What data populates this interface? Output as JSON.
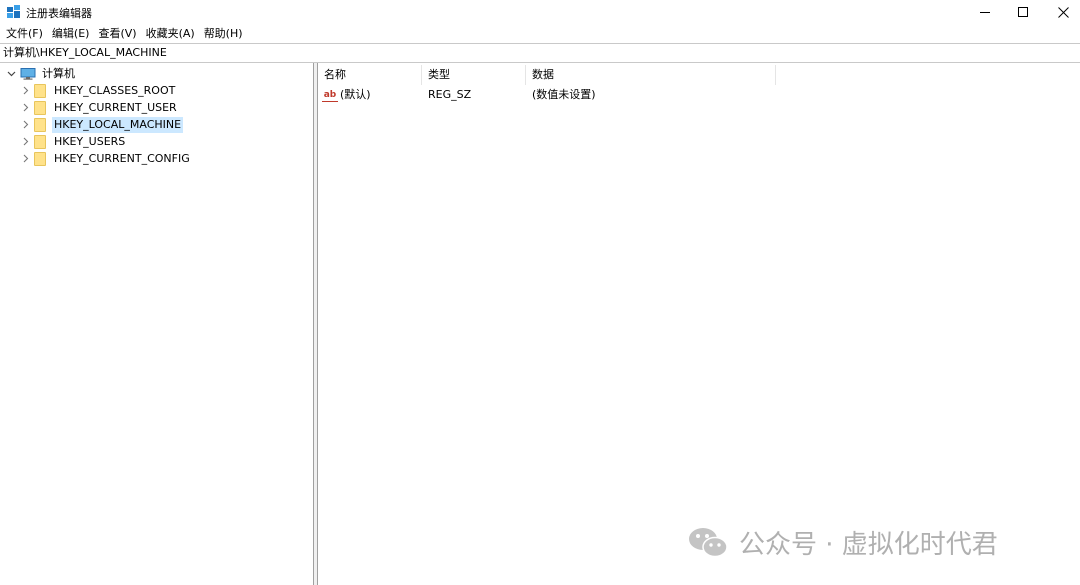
{
  "window": {
    "title": "注册表编辑器",
    "app_icon": "regedit-icon",
    "controls": [
      "minimize-icon",
      "maximize-icon",
      "close-icon"
    ]
  },
  "menu": [
    {
      "label": "文件(F)"
    },
    {
      "label": "编辑(E)"
    },
    {
      "label": "查看(V)"
    },
    {
      "label": "收藏夹(A)"
    },
    {
      "label": "帮助(H)"
    }
  ],
  "address": "计算机\\HKEY_LOCAL_MACHINE",
  "tree": {
    "root": {
      "label": "计算机",
      "icon": "computer-icon",
      "expanded": true
    },
    "children": [
      {
        "label": "HKEY_CLASSES_ROOT",
        "icon": "folder-icon"
      },
      {
        "label": "HKEY_CURRENT_USER",
        "icon": "folder-icon"
      },
      {
        "label": "HKEY_LOCAL_MACHINE",
        "icon": "folder-icon",
        "selected": true
      },
      {
        "label": "HKEY_USERS",
        "icon": "folder-icon"
      },
      {
        "label": "HKEY_CURRENT_CONFIG",
        "icon": "folder-icon"
      }
    ]
  },
  "list": {
    "columns": [
      "名称",
      "类型",
      "数据"
    ],
    "rows": [
      {
        "name": "(默认)",
        "type": "REG_SZ",
        "data": "(数值未设置)",
        "icon": "string-value-icon",
        "icon_text": "ab"
      }
    ]
  },
  "watermark": {
    "text": "公众号 · 虚拟化时代君",
    "icon": "wechat-icon"
  },
  "colors": {
    "selection": "#cce8ff",
    "folder": "#ffe28a",
    "watermark": "#b0b0b0"
  }
}
